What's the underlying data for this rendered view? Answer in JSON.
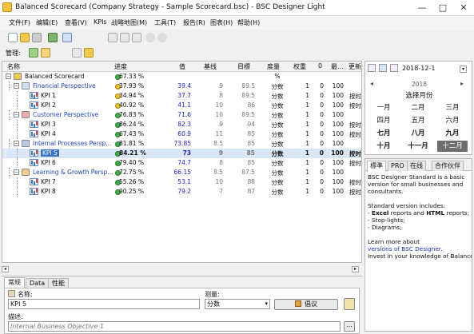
{
  "window": {
    "title": "Balanced Scorecard (Company Strategy - Sample Scorecard.bsc) - BSC Designer Light",
    "controls": [
      "—",
      "□",
      "✕"
    ]
  },
  "menu": [
    "文件(F)",
    "编辑(E)",
    "查看(V)",
    "KPIs",
    "战略地图(M)",
    "工具(T)",
    "报告(R)",
    "图表(H)",
    "帮助(H)"
  ],
  "toolbar2": {
    "manage_label": "管理:"
  },
  "grid": {
    "columns": [
      "名称",
      "进度",
      "值",
      "基线",
      "目標",
      "度量",
      "权重",
      "0",
      "最...",
      "更新"
    ],
    "rows": [
      {
        "level": 0,
        "expander": "−",
        "icon": "folder",
        "name": "Balanced Scorecard",
        "dot": "#3cb043",
        "progress": "67.33 %",
        "value": "",
        "baseline": "",
        "target": "",
        "measure": "%",
        "weight": "",
        "min": "",
        "max": "",
        "update": "",
        "style": "normal"
      },
      {
        "level": 1,
        "expander": "−",
        "icon": "chart",
        "name": "Financial Perspective",
        "dot": "#f0c419",
        "progress": "37.93 %",
        "value": "39.4",
        "baseline": "9",
        "target": "89.5",
        "measure": "分数",
        "weight": "1",
        "min": "0",
        "max": "100",
        "update": "",
        "style": "perspective"
      },
      {
        "level": 2,
        "expander": "",
        "icon": "kpi",
        "name": "KPI 1",
        "dot": "#f0c419",
        "progress": "34.94 %",
        "value": "37.7",
        "baseline": "8",
        "target": "89.5",
        "measure": "分数",
        "weight": "1",
        "min": "0",
        "max": "100",
        "update": "按时",
        "style": "kpi"
      },
      {
        "level": 2,
        "expander": "",
        "icon": "kpi",
        "name": "KPI 2",
        "dot": "#f0c419",
        "progress": "40.92 %",
        "value": "41.1",
        "baseline": "10",
        "target": "86",
        "measure": "分数",
        "weight": "1",
        "min": "0",
        "max": "100",
        "update": "按时",
        "style": "kpi"
      },
      {
        "level": 1,
        "expander": "−",
        "icon": "people",
        "name": "Customer Perspective",
        "dot": "#3cb043",
        "progress": "76.83 %",
        "value": "71.6",
        "baseline": "10",
        "target": "89.5",
        "measure": "分数",
        "weight": "1",
        "min": "0",
        "max": "100",
        "update": "",
        "style": "perspective"
      },
      {
        "level": 2,
        "expander": "",
        "icon": "kpi",
        "name": "KPI 3",
        "dot": "#3cb043",
        "progress": "86.24 %",
        "value": "82.3",
        "baseline": "9",
        "target": "94",
        "measure": "分数",
        "weight": "1",
        "min": "0",
        "max": "100",
        "update": "按时",
        "style": "kpi"
      },
      {
        "level": 2,
        "expander": "",
        "icon": "kpi",
        "name": "KPI 4",
        "dot": "#3cb043",
        "progress": "67.43 %",
        "value": "60.9",
        "baseline": "11",
        "target": "85",
        "measure": "分数",
        "weight": "1",
        "min": "0",
        "max": "100",
        "update": "按时",
        "style": "kpi"
      },
      {
        "level": 1,
        "expander": "−",
        "icon": "gear",
        "name": "Internal Processes Persp...",
        "dot": "#3cb043",
        "progress": "81.81 %",
        "value": "73.85",
        "baseline": "8.5",
        "target": "85",
        "measure": "分数",
        "weight": "1",
        "min": "0",
        "max": "100",
        "update": "",
        "style": "perspective"
      },
      {
        "level": 2,
        "expander": "",
        "icon": "kpi",
        "name": "KPI 5",
        "dot": "#3cb043",
        "progress": "84.21 %",
        "value": "73",
        "baseline": "9",
        "target": "85",
        "measure": "分数",
        "weight": "1",
        "min": "0",
        "max": "100",
        "update": "按时",
        "style": "selected"
      },
      {
        "level": 2,
        "expander": "",
        "icon": "kpi",
        "name": "KPI 6",
        "dot": "#3cb043",
        "progress": "79.40 %",
        "value": "74.7",
        "baseline": "8",
        "target": "85",
        "measure": "分数",
        "weight": "1",
        "min": "0",
        "max": "100",
        "update": "按时",
        "style": "kpi"
      },
      {
        "level": 1,
        "expander": "−",
        "icon": "growth",
        "name": "Learning & Growth Persp...",
        "dot": "#3cb043",
        "progress": "72.75 %",
        "value": "66.15",
        "baseline": "8.5",
        "target": "87.5",
        "measure": "分数",
        "weight": "1",
        "min": "0",
        "max": "100",
        "update": "",
        "style": "perspective"
      },
      {
        "level": 2,
        "expander": "",
        "icon": "kpi",
        "name": "KPI 7",
        "dot": "#3cb043",
        "progress": "55.26 %",
        "value": "53.1",
        "baseline": "10",
        "target": "88",
        "measure": "分数",
        "weight": "1",
        "min": "0",
        "max": "100",
        "update": "按时",
        "style": "kpi"
      },
      {
        "level": 2,
        "expander": "",
        "icon": "kpi",
        "name": "KPI 8",
        "dot": "#3cb043",
        "progress": "90.25 %",
        "value": "79.2",
        "baseline": "7",
        "target": "87",
        "measure": "分数",
        "weight": "1",
        "min": "0",
        "max": "100",
        "update": "按时",
        "style": "kpi"
      }
    ]
  },
  "calendar": {
    "date": "2018-12-1",
    "dropdown": "▾",
    "year": "2018",
    "caption": "选择月份",
    "prev": "◂",
    "next": "▸",
    "months": [
      "一月",
      "二月",
      "三月",
      "四月",
      "五月",
      "六月",
      "七月",
      "八月",
      "九月",
      "十月",
      "十一月",
      "十二月"
    ],
    "selected_month_index": 11
  },
  "info": {
    "tabs": [
      "標準",
      "PRO",
      "在线",
      "合作伙伴"
    ],
    "active_tab": 0,
    "lines": [
      "BSC Designer Standard is a basic",
      "version for small businesses and",
      "consultants.",
      "",
      "Standard version includes:",
      " - Excel reports and HTML reports;",
      " - Stop-lights;",
      " - Diagrams;",
      "",
      "Learn more about",
      "versions of BSC Designer.",
      "Invest in your knowledge of Balanced Sc"
    ]
  },
  "properties": {
    "tabs": [
      "常规",
      "Data",
      "性能"
    ],
    "name_label": "名称:",
    "name_value": "KPI 5",
    "measure_label": "测量:",
    "measure_value": "分数",
    "suggest_button": "倡议",
    "desc_label": "描述:",
    "desc_value": "Internal Business Objective 1"
  }
}
